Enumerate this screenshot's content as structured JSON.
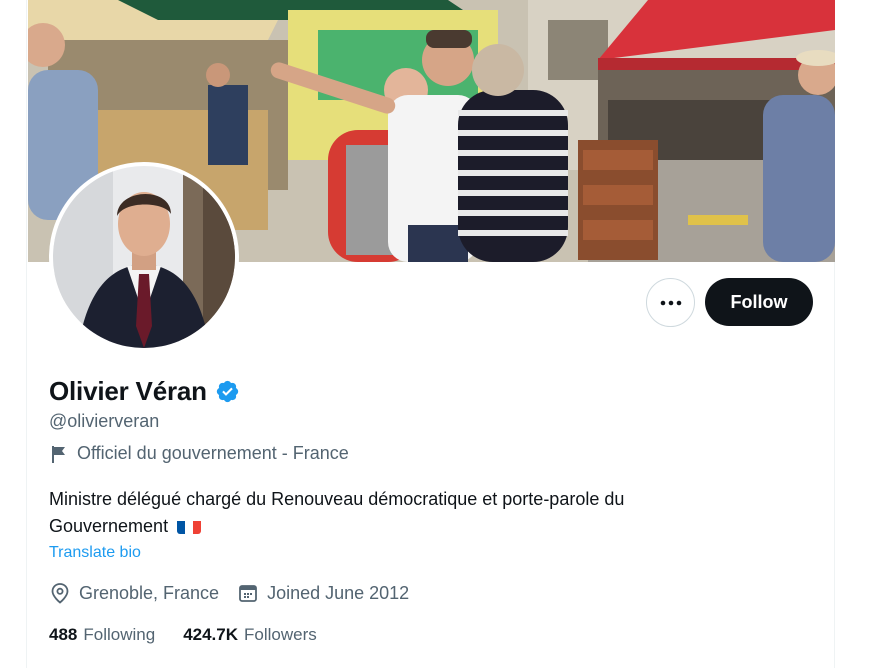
{
  "profile": {
    "name": "Olivier Véran",
    "handle": "@olivierveran",
    "affiliation": "Officiel du gouvernement - France",
    "bio": "Ministre délégué chargé du Renouveau démocratique et porte-parole du Gouvernement",
    "translate_label": "Translate bio",
    "location": "Grenoble, France",
    "joined": "Joined June 2012"
  },
  "actions": {
    "follow_label": "Follow"
  },
  "stats": {
    "following_count": "488",
    "following_label": "Following",
    "followers_count": "424.7K",
    "followers_label": "Followers"
  },
  "colors": {
    "verified": "#1d9bf0",
    "link": "#1d9bf0",
    "follow_button": "#0f1419",
    "secondary_text": "#536471"
  },
  "icons": {
    "verified": "verified-badge-icon",
    "affiliation": "flag-icon",
    "location": "location-pin-icon",
    "joined": "calendar-icon",
    "more": "more-icon"
  }
}
